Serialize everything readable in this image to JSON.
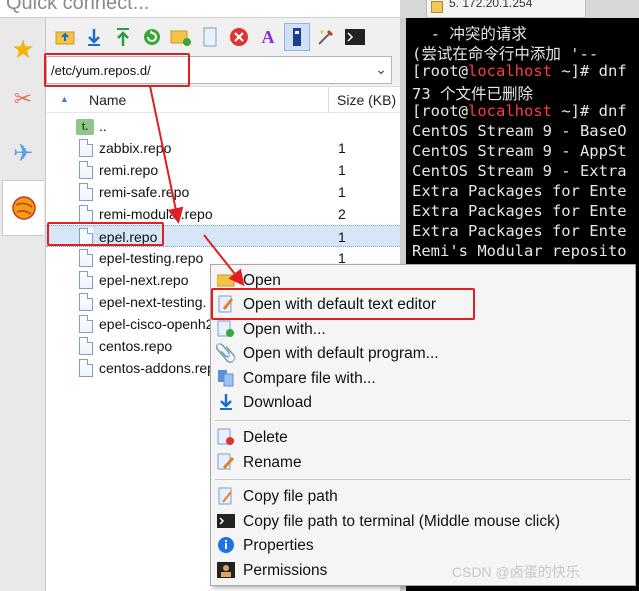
{
  "quick_connect": {
    "placeholder": "Quick connect..."
  },
  "side_tabs": [
    {
      "icon": "star-icon"
    },
    {
      "icon": "tools-icon"
    },
    {
      "icon": "send-icon"
    },
    {
      "icon": "sftp-icon",
      "active": true
    }
  ],
  "toolbar": {
    "buttons": [
      "parent-folder",
      "download",
      "upload",
      "refresh",
      "new-folder",
      "new-file",
      "delete",
      "rename",
      "properties",
      "toggle-follow-terminal",
      "open-terminal"
    ]
  },
  "path": {
    "value": "/etc/yum.repos.d/"
  },
  "list": {
    "header_name": "Name",
    "header_size": "Size (KB)",
    "rows": [
      {
        "name": "..",
        "size": "",
        "type": "parent"
      },
      {
        "name": "zabbix.repo",
        "size": "1"
      },
      {
        "name": "remi.repo",
        "size": "1"
      },
      {
        "name": "remi-safe.repo",
        "size": "1"
      },
      {
        "name": "remi-modular.repo",
        "size": "2"
      },
      {
        "name": "epel.repo",
        "size": "1",
        "selected": true
      },
      {
        "name": "epel-testing.repo",
        "size": "1"
      },
      {
        "name": "epel-next.repo",
        "size": ""
      },
      {
        "name": "epel-next-testing.",
        "size": ""
      },
      {
        "name": "epel-cisco-openh2",
        "size": ""
      },
      {
        "name": "centos.repo",
        "size": ""
      },
      {
        "name": "centos-addons.rep",
        "size": ""
      }
    ]
  },
  "terminal": {
    "tab_title": "5. 172.20.1.254",
    "lines": [
      {
        "text": "  - 冲突的请求"
      },
      {
        "text": "(尝试在命令行中添加 '--"
      },
      {
        "prefix": "[root@",
        "host": "localhost",
        "suffix": " ~]# dnf"
      },
      {
        "text": "73 个文件已删除"
      },
      {
        "prefix": "[root@",
        "host": "localhost",
        "suffix": " ~]# dnf"
      },
      {
        "text": "CentOS Stream 9 - BaseO"
      },
      {
        "text": "CentOS Stream 9 - AppSt"
      },
      {
        "text": "CentOS Stream 9 - Extra"
      },
      {
        "text": "Extra Packages for Ente"
      },
      {
        "text": "Extra Packages for Ente"
      },
      {
        "text": "Extra Packages for Ente"
      },
      {
        "text": "Remi's Modular reposito"
      }
    ]
  },
  "context_menu": {
    "items": [
      {
        "label": "Open",
        "icon": "folder-open-icon"
      },
      {
        "label": "Open with default text editor",
        "icon": "edit-icon",
        "highlighted": true
      },
      {
        "label": "Open with...",
        "icon": "open-with-icon"
      },
      {
        "label": "Open with default program...",
        "icon": "paperclip-icon"
      },
      {
        "label": "Compare file with...",
        "icon": "compare-icon"
      },
      {
        "label": "Download",
        "icon": "download-icon"
      },
      {
        "separator": true
      },
      {
        "label": "Delete",
        "icon": "delete-icon"
      },
      {
        "label": "Rename",
        "icon": "rename-icon"
      },
      {
        "separator": true
      },
      {
        "label": "Copy file path",
        "icon": "copy-path-icon"
      },
      {
        "label": "Copy file path to terminal (Middle mouse click)",
        "icon": "terminal-icon"
      },
      {
        "label": "Properties",
        "icon": "info-icon"
      },
      {
        "label": "Permissions",
        "icon": "permissions-icon"
      }
    ]
  },
  "watermark": "CSDN @卤蛋的快乐",
  "colors": {
    "annotation": "#e02020",
    "terminal_host": "#ff3b3b",
    "selection": "#d6e6f7"
  }
}
